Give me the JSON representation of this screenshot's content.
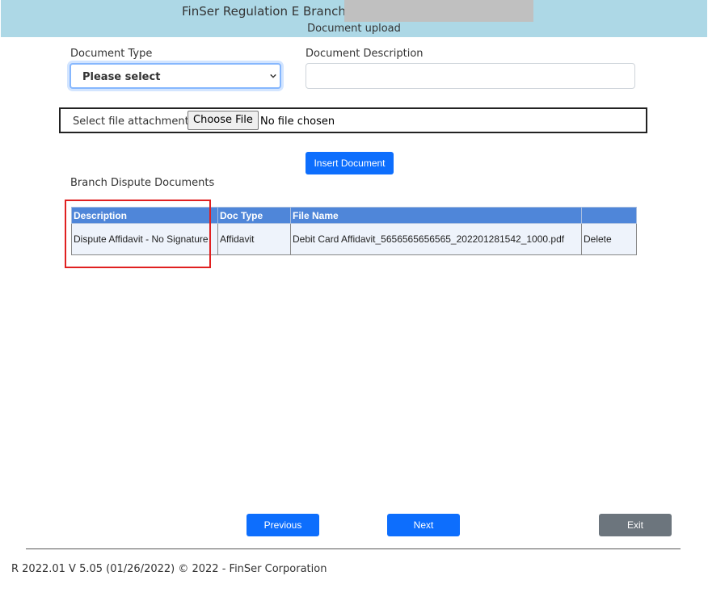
{
  "header": {
    "title": "FinSer Regulation E Branch -",
    "subtitle": "Document upload"
  },
  "form": {
    "doc_type_label": "Document Type",
    "doc_type_value": "Please select",
    "doc_desc_label": "Document Description",
    "doc_desc_value": "",
    "file_label": "Select file attachment",
    "choose_file_label": "Choose File",
    "no_file_text": "No file chosen",
    "insert_button": "Insert Document"
  },
  "documents": {
    "title": "Branch Dispute Documents",
    "columns": [
      "Description",
      "Doc Type",
      "File Name",
      ""
    ],
    "rows": [
      {
        "description": "Dispute Affidavit - No Signature",
        "doc_type": "Affidavit",
        "file_name": "Debit Card Affidavit_5656565656565_202201281542_1000.pdf",
        "action": "Delete"
      }
    ]
  },
  "nav": {
    "previous": "Previous",
    "next": "Next",
    "exit": "Exit"
  },
  "footer": {
    "text": "R 2022.01 V 5.05 (01/26/2022) © 2022 - FinSer Corporation"
  },
  "colors": {
    "header_bg": "#add8e6",
    "primary": "#0d6efd",
    "secondary": "#6c757d",
    "table_header": "#4f86d9",
    "highlight": "#e02020"
  },
  "icons": {
    "select_arrow": "chevron-down-icon"
  }
}
